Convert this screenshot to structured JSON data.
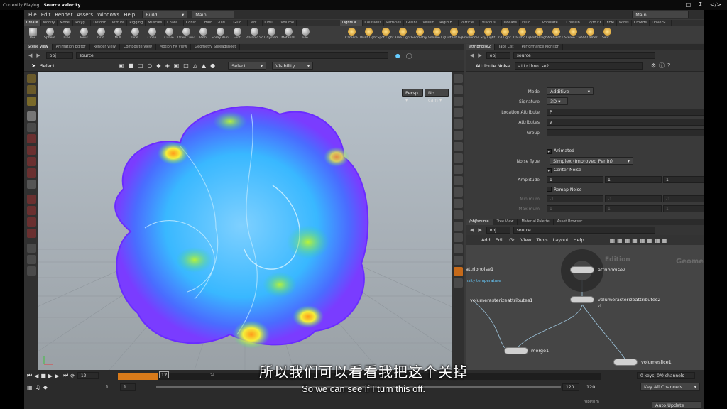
{
  "now_playing": {
    "label": "Currently Playing:",
    "title": "Source velocity"
  },
  "menu": {
    "items": [
      "File",
      "Edit",
      "Render",
      "Assets",
      "Windows",
      "Help"
    ],
    "build": "Build",
    "desktop": "Main",
    "right_desktop": "Main"
  },
  "shelf_tabs_left": [
    "Create",
    "Modify",
    "Model",
    "Polyg...",
    "Deform",
    "Texture",
    "Rigging",
    "Muscles",
    "Chara...",
    "Const...",
    "Hair",
    "Guid...",
    "Guid...",
    "Terr...",
    "Clou...",
    "Volume"
  ],
  "shelf_tabs_right": [
    "Lights a...",
    "Collisions",
    "Particles",
    "Grains",
    "Vellum",
    "Rigid B...",
    "Particle...",
    "Viscous...",
    "Oceans",
    "Fluid C...",
    "Populate...",
    "Contain...",
    "Pyro FX",
    "FEM",
    "Wires",
    "Crowds",
    "Drive Si..."
  ],
  "tools_left": [
    "Box",
    "Sphere",
    "Tube",
    "Torus",
    "Grid",
    "Null",
    "Line",
    "Circle",
    "Curve",
    "Draw Curve",
    "Path",
    "Spray Paint",
    "Font",
    "Platonic Solids",
    "L-System",
    "Metaball",
    "File"
  ],
  "tools_right": [
    "Camera",
    "Point Light",
    "Spot Light",
    "Area Light",
    "Geometry Light",
    "Volume Light",
    "Distant Light",
    "Environment Light",
    "Sky Light",
    "GI Light",
    "Caustic Light",
    "Portal Light",
    "Ambient Light",
    "Stereo Camera",
    "VR Camera",
    "Swit..."
  ],
  "viewer": {
    "tabs": [
      "Scene View",
      "Animation Editor",
      "Render View",
      "Composite View",
      "Motion FX View",
      "Geometry Spreadsheet"
    ],
    "path": [
      "obj",
      "source"
    ],
    "tool": "Select",
    "select_mode": "Select",
    "visibility": "Visibility",
    "persp": "Persp",
    "cam": "No cam"
  },
  "parm_tabs": [
    "attribnoise2",
    "Take List",
    "Performance Monitor"
  ],
  "parm_path": [
    "obj",
    "source"
  ],
  "parm": {
    "node_type": "Attribute Noise",
    "node_name": "attribnoise2",
    "mode_label": "Mode",
    "mode": "Additive",
    "signature_label": "Signature",
    "signature": "3D",
    "location_label": "Location Attribute",
    "location": "P",
    "attributes_label": "Attributes",
    "attributes": "v",
    "group_label": "Group",
    "group": "",
    "animated": "Animated",
    "noise_type_label": "Noise Type",
    "noise_type": "Simplex (Improved Perlin)",
    "center_noise": "Center Noise",
    "amplitude_label": "Amplitude",
    "amplitude": [
      "1",
      "1",
      "1"
    ],
    "remap": "Remap Noise",
    "minimum_label": "Minimum",
    "minimum": [
      "-1",
      "-1",
      "-1"
    ],
    "maximum_label": "Maximum",
    "maximum": [
      "1",
      "1",
      "1"
    ]
  },
  "net_tabs": [
    "/obj/source",
    "Tree View",
    "Material Palette",
    "Asset Browser"
  ],
  "net_path": [
    "obj",
    "source"
  ],
  "net_menu": [
    "Add",
    "Edit",
    "Go",
    "View",
    "Tools",
    "Layout",
    "Help"
  ],
  "network": {
    "watermark_edition": "Edition",
    "watermark_context": "Geometry",
    "nodes": {
      "attribnoise1": "attribnoise1",
      "attribnoise1_sub": "nsity temperature",
      "attribnoise2": "attribnoise2",
      "vra1": "volumerasterizeattributes1",
      "vra2": "volumerasterizeattributes2",
      "vra2_sub": "vl",
      "merge1": "merge1",
      "volumeslice1": "volumeslice1"
    }
  },
  "timeline": {
    "current_frame": "12",
    "frame_input": "12",
    "start": "1",
    "start2": "1",
    "end": "120",
    "end2": "120",
    "tick_24": "24",
    "keys": "0 keys, 0/0 channels",
    "key_all": "Key All Channels",
    "auto_update": "Auto Update",
    "obj_path": "/obj/sim"
  },
  "subtitles": {
    "chinese": "所以我们可以看看我把这个关掉",
    "english": "So we can see if I turn this off."
  }
}
